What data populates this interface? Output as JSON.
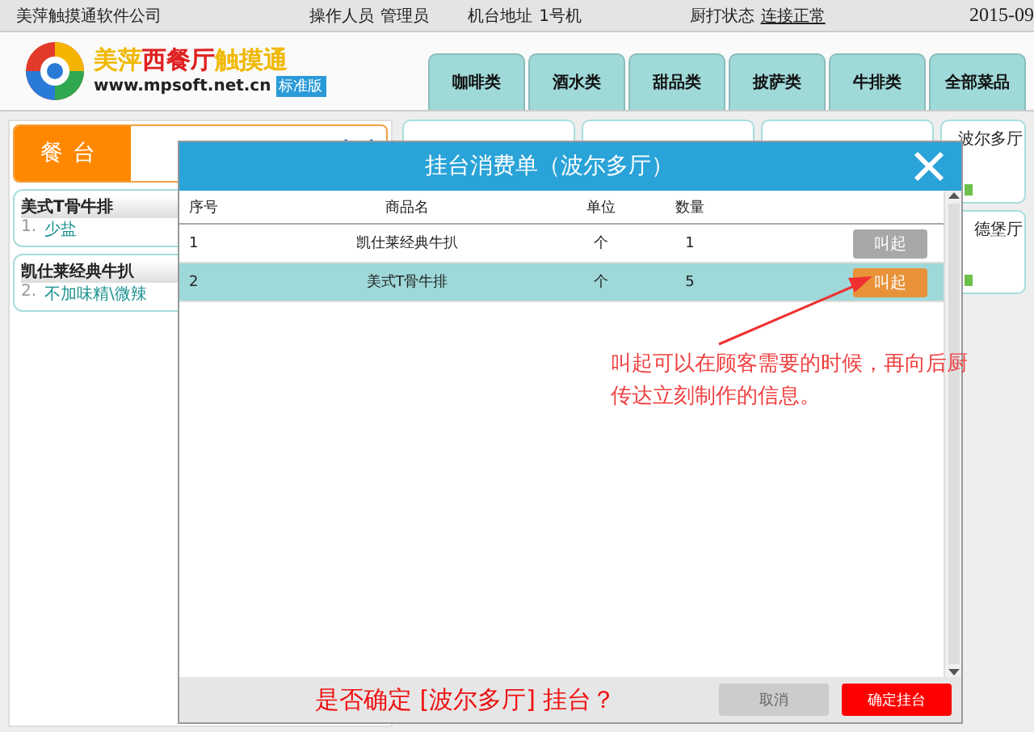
{
  "top_bar": {
    "company": "美萍触摸通软件公司",
    "operator_label": "操作人员",
    "operator": "管理员",
    "terminal_label": "机台地址",
    "terminal": "1号机",
    "kitchen_label": "厨打状态",
    "kitchen_status": "连接正常",
    "date": "2015-09"
  },
  "logo": {
    "title_parts": [
      {
        "text": "美萍",
        "color": "#f0b800"
      },
      {
        "text": "西餐厅",
        "color": "#e02020"
      },
      {
        "text": "触摸通",
        "color": "#f0b800"
      }
    ],
    "url": "www.mpsoft.net.cn",
    "badge": "标准版"
  },
  "tabs": [
    {
      "label": "咖啡类",
      "selected": false
    },
    {
      "label": "酒水类",
      "selected": false
    },
    {
      "label": "甜品类",
      "selected": false
    },
    {
      "label": "披萨类",
      "selected": false
    },
    {
      "label": "牛排类",
      "selected": false
    },
    {
      "label": "全部菜品",
      "selected": false
    }
  ],
  "left_panel": {
    "label": "餐台",
    "orders": [
      {
        "name": "美式T骨牛排",
        "index": "1.",
        "note": "少盐"
      },
      {
        "name": "凯仕莱经典牛扒",
        "index": "2.",
        "note": "不加味精\\微辣"
      }
    ]
  },
  "tables": [
    {
      "name": "波尔多厅"
    },
    {
      "name": "德堡厅"
    }
  ],
  "dialog": {
    "title": "挂台消费单（波尔多厅）",
    "columns": [
      "序号",
      "商品名",
      "单位",
      "数量"
    ],
    "rows": [
      {
        "cells": [
          "1",
          "凯仕莱经典牛扒",
          "个",
          "1"
        ],
        "selected": false,
        "button": "叫起",
        "disabled": true
      },
      {
        "cells": [
          "2",
          "美式T骨牛排",
          "个",
          "5"
        ],
        "selected": true,
        "button": "叫起",
        "disabled": false
      }
    ],
    "question": "是否确定 [波尔多厅] 挂台？",
    "cancel": "取消",
    "confirm": "确定挂台"
  },
  "annotation": "叫起可以在顾客需要的时候，再向后厨传达立刻制作的信息。"
}
